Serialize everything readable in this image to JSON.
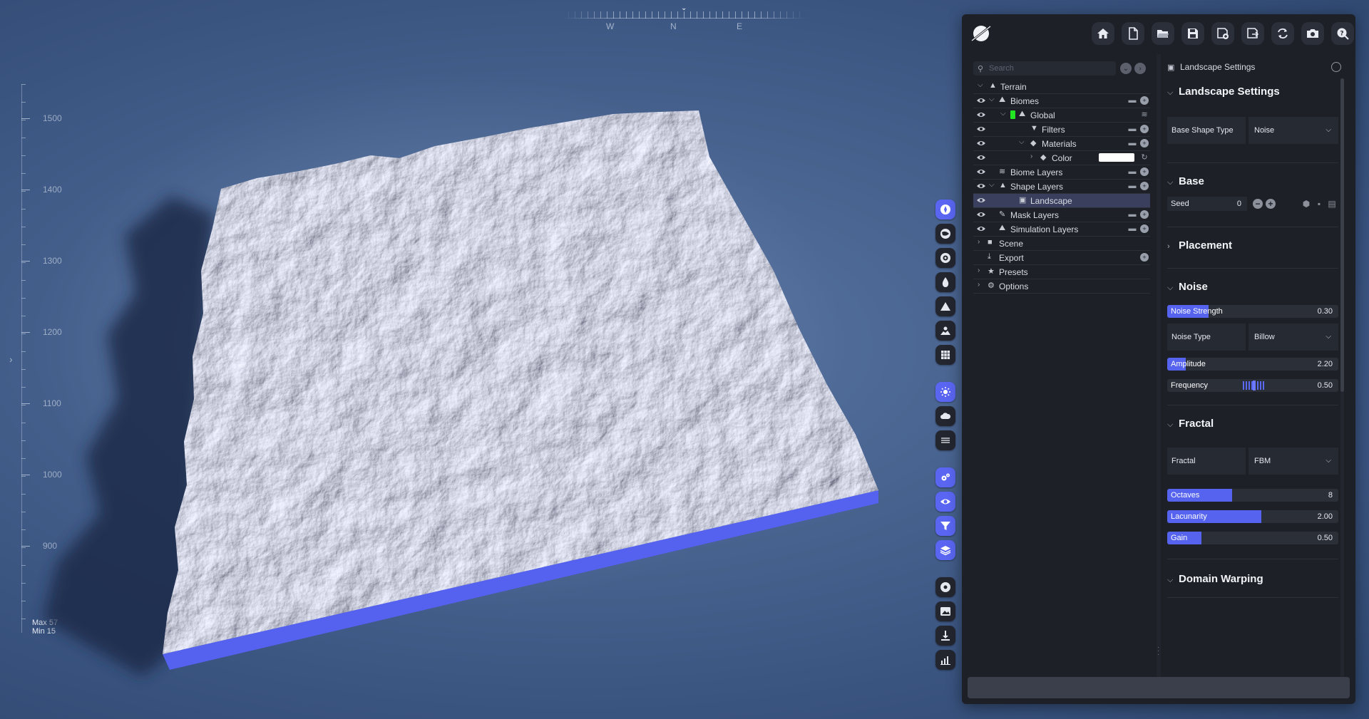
{
  "compass": {
    "labels": [
      "W",
      "N",
      "E"
    ]
  },
  "ruler": {
    "ticks": [
      "1500",
      "1400",
      "1300",
      "1200",
      "1100",
      "1000",
      "900"
    ],
    "max_label": "Max 57",
    "min_label": "Min 15"
  },
  "toolbar": {
    "icons": [
      "home-icon",
      "new-file-icon",
      "open-folder-icon",
      "save-icon",
      "save-as-icon",
      "export-file-icon",
      "refresh-icon",
      "camera-icon",
      "help-icon"
    ]
  },
  "tree": {
    "search_placeholder": "Search",
    "items": [
      {
        "label": "Terrain"
      },
      {
        "label": "Biomes"
      },
      {
        "label": "Global"
      },
      {
        "label": "Filters"
      },
      {
        "label": "Materials"
      },
      {
        "label": "Color"
      },
      {
        "label": "Biome Layers"
      },
      {
        "label": "Shape Layers"
      },
      {
        "label": "Landscape"
      },
      {
        "label": "Mask Layers"
      },
      {
        "label": "Simulation Layers"
      },
      {
        "label": "Scene"
      },
      {
        "label": "Export"
      },
      {
        "label": "Presets"
      },
      {
        "label": "Options"
      }
    ]
  },
  "settings": {
    "header": "Landscape Settings",
    "sections": {
      "landscape": {
        "title": "Landscape Settings",
        "base_shape_type": {
          "label": "Base Shape Type",
          "value": "Noise"
        }
      },
      "base": {
        "title": "Base",
        "seed": {
          "label": "Seed",
          "value": "0"
        }
      },
      "placement": {
        "title": "Placement"
      },
      "noise": {
        "title": "Noise",
        "noise_strength": {
          "label": "Noise Strength",
          "value": "0.30",
          "fill": 0.24
        },
        "noise_type": {
          "label": "Noise Type",
          "value": "Billow"
        },
        "amplitude": {
          "label": "Amplitude",
          "value": "2.20",
          "fill": 0.11
        },
        "frequency": {
          "label": "Frequency",
          "value": "0.50"
        }
      },
      "fractal": {
        "title": "Fractal",
        "fractal": {
          "label": "Fractal",
          "value": "FBM"
        },
        "octaves": {
          "label": "Octaves",
          "value": "8",
          "fill": 0.38
        },
        "lacunarity": {
          "label": "Lacunarity",
          "value": "2.00",
          "fill": 0.55
        },
        "gain": {
          "label": "Gain",
          "value": "0.50",
          "fill": 0.2
        }
      },
      "domain_warping": {
        "title": "Domain Warping"
      }
    }
  },
  "colors": {
    "accent": "#5563ee",
    "panel": "#1d2027",
    "material_color": "#ffffff",
    "global_indicator": "#22e622"
  }
}
